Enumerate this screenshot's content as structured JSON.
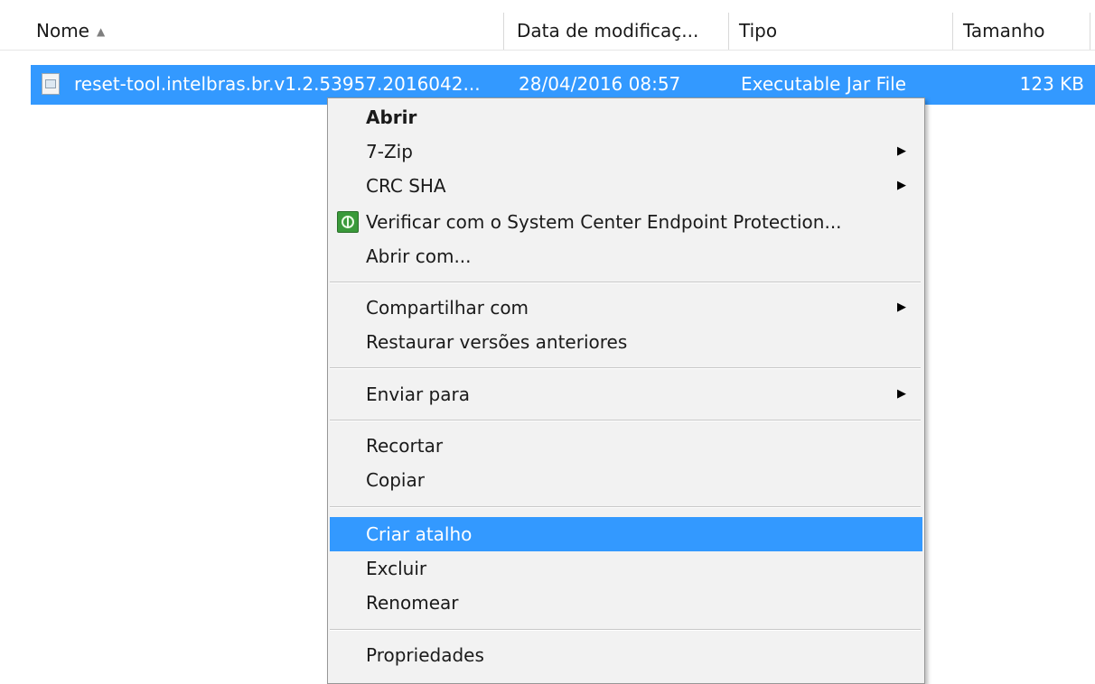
{
  "columns": {
    "name": "Nome",
    "sort_indicator": "▲",
    "date": "Data de modificaç...",
    "type": "Tipo",
    "size": "Tamanho"
  },
  "file": {
    "name": "reset-tool.intelbras.br.v1.2.53957.2016042...",
    "date": "28/04/2016 08:57",
    "type": "Executable Jar File",
    "size": "123 KB",
    "icon": "jar-file-icon"
  },
  "menu": {
    "items": [
      {
        "label": "Abrir",
        "bold": true
      },
      {
        "label": "7-Zip",
        "submenu": true
      },
      {
        "label": "CRC SHA",
        "submenu": true
      },
      {
        "label": "Verificar com o System Center Endpoint Protection...",
        "icon": "endpoint-protection-icon"
      },
      {
        "label": "Abrir com..."
      },
      {
        "label": "Compartilhar com",
        "submenu": true
      },
      {
        "label": "Restaurar versões anteriores"
      },
      {
        "label": "Enviar para",
        "submenu": true
      },
      {
        "label": "Recortar"
      },
      {
        "label": "Copiar"
      },
      {
        "label": "Criar atalho",
        "highlighted": true
      },
      {
        "label": "Excluir"
      },
      {
        "label": "Renomear"
      },
      {
        "label": "Propriedades"
      }
    ],
    "submenu_arrow": "▶"
  },
  "colors": {
    "selection": "#3399ff",
    "menu_background": "#f2f2f2"
  }
}
